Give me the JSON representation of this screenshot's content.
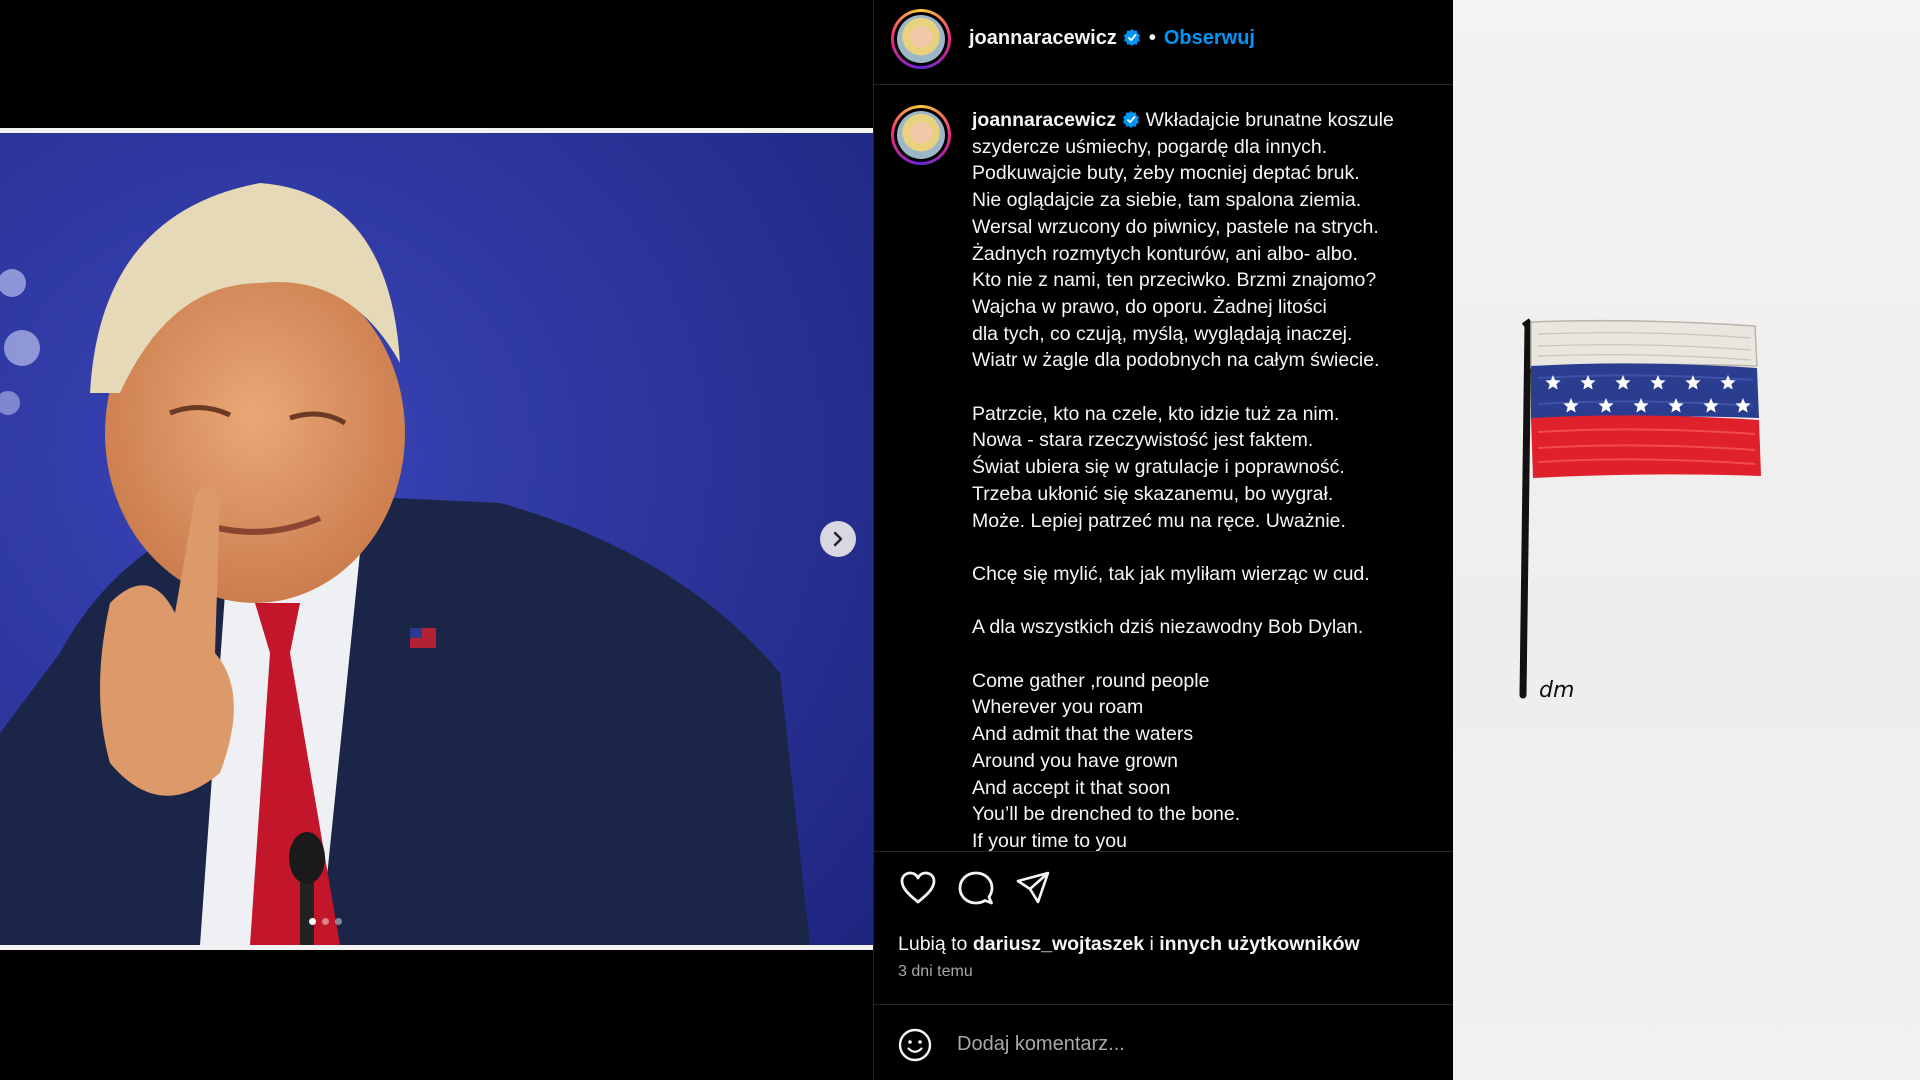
{
  "post": {
    "username": "joannaracewicz",
    "follow_label": "Obserwuj",
    "separator": "•",
    "caption_lines": [
      "Wkładajcie brunatne koszule",
      "szydercze uśmiechy, pogardę dla innych.",
      "Podkuwajcie buty, żeby mocniej deptać bruk.",
      "Nie oglądajcie za siebie, tam spalona ziemia.",
      "Wersal wrzucony do piwnicy, pastele na strych.",
      "Żadnych rozmytych konturów, ani albo- albo.",
      "Kto nie z nami, ten przeciwko. Brzmi znajomo?",
      "Wajcha w prawo, do oporu. Żadnej litości",
      "dla tych, co czują, myślą, wyglądają inaczej.",
      "Wiatr w żagle dla podobnych na całym świecie.",
      "",
      "Patrzcie, kto na czele, kto idzie tuż za nim.",
      "Nowa - stara rzeczywistość jest faktem.",
      "Świat ubiera się w gratulacje i poprawność.",
      "Trzeba ukłonić się skazanemu, bo wygrał.",
      "Może. Lepiej patrzeć mu na ręce. Uważnie.",
      "",
      "Chcę się mylić, tak jak myliłam wierząc w cud.",
      "",
      "A dla wszystkich dziś niezawodny Bob Dylan.",
      "",
      "Come gather ,round people",
      "Wherever you roam",
      "And admit that the waters",
      "Around you have grown",
      "And accept it that soon",
      "You’ll be drenched to the bone.",
      "If your time to you"
    ],
    "likes_prefix": "Lubią to",
    "likes_user": "dariusz_wojtaszek",
    "likes_and": "i",
    "likes_others": "innych użytkowników",
    "time_ago": "3 dni temu",
    "comment_placeholder": "Dodaj komentarz...",
    "carousel": {
      "total": 3,
      "current": 1
    }
  },
  "icons": [
    "verified-badge-icon",
    "chevron-right-icon",
    "heart-icon",
    "comment-icon",
    "share-icon",
    "emoji-icon"
  ],
  "colors": {
    "link_blue": "#0095f6",
    "verified_blue": "#0095f6",
    "background": "#000000",
    "muted": "#a8a8a8"
  },
  "paper_signature": "dm"
}
